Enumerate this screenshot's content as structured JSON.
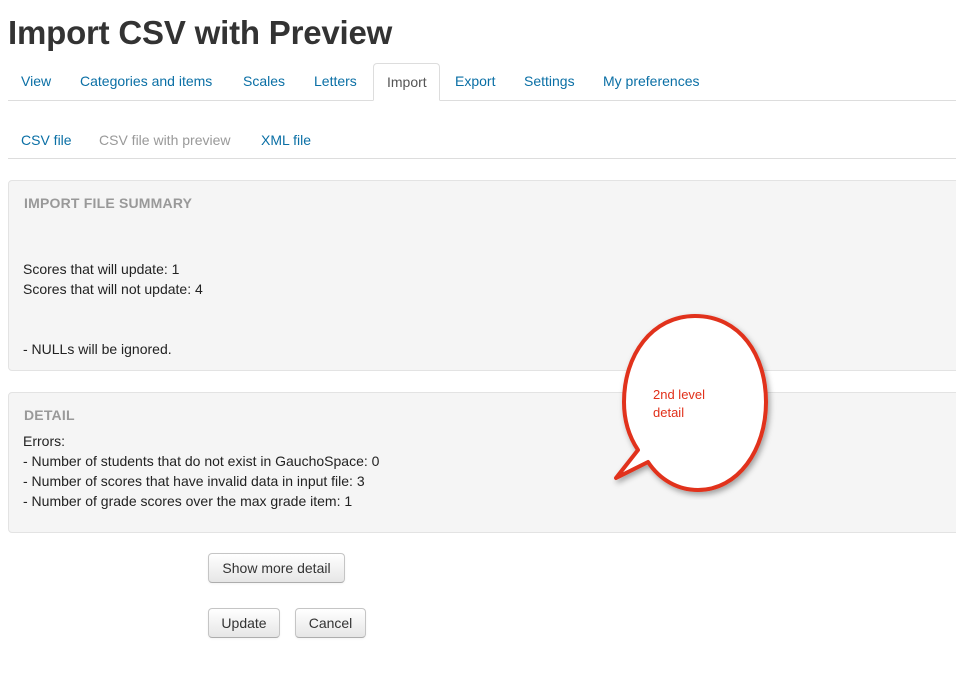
{
  "page": {
    "title": "Import CSV with Preview"
  },
  "tabs": [
    {
      "label": "View"
    },
    {
      "label": "Categories and items"
    },
    {
      "label": "Scales"
    },
    {
      "label": "Letters"
    },
    {
      "label": "Import",
      "active": true
    },
    {
      "label": "Export"
    },
    {
      "label": "Settings"
    },
    {
      "label": "My preferences"
    }
  ],
  "subtabs": [
    {
      "label": "CSV file"
    },
    {
      "label": "CSV file with preview",
      "current": true
    },
    {
      "label": "XML file"
    }
  ],
  "summary": {
    "heading": "IMPORT FILE SUMMARY",
    "will_update": "Scores that will update: 1",
    "will_not_update": "Scores that will not update: 4",
    "nulls_note": "- NULLs will be ignored."
  },
  "detail": {
    "heading": "DETAIL",
    "errors_label": "Errors:",
    "lines": [
      "- Number of students that do not exist in GauchoSpace: 0",
      "- Number of scores that have invalid data in input file: 3",
      "- Number of grade scores over the max grade item: 1"
    ]
  },
  "buttons": {
    "show_more": "Show more detail",
    "update": "Update",
    "cancel": "Cancel"
  },
  "callout": {
    "line1": "2nd level",
    "line2": "detail",
    "color": "#e1301a"
  }
}
